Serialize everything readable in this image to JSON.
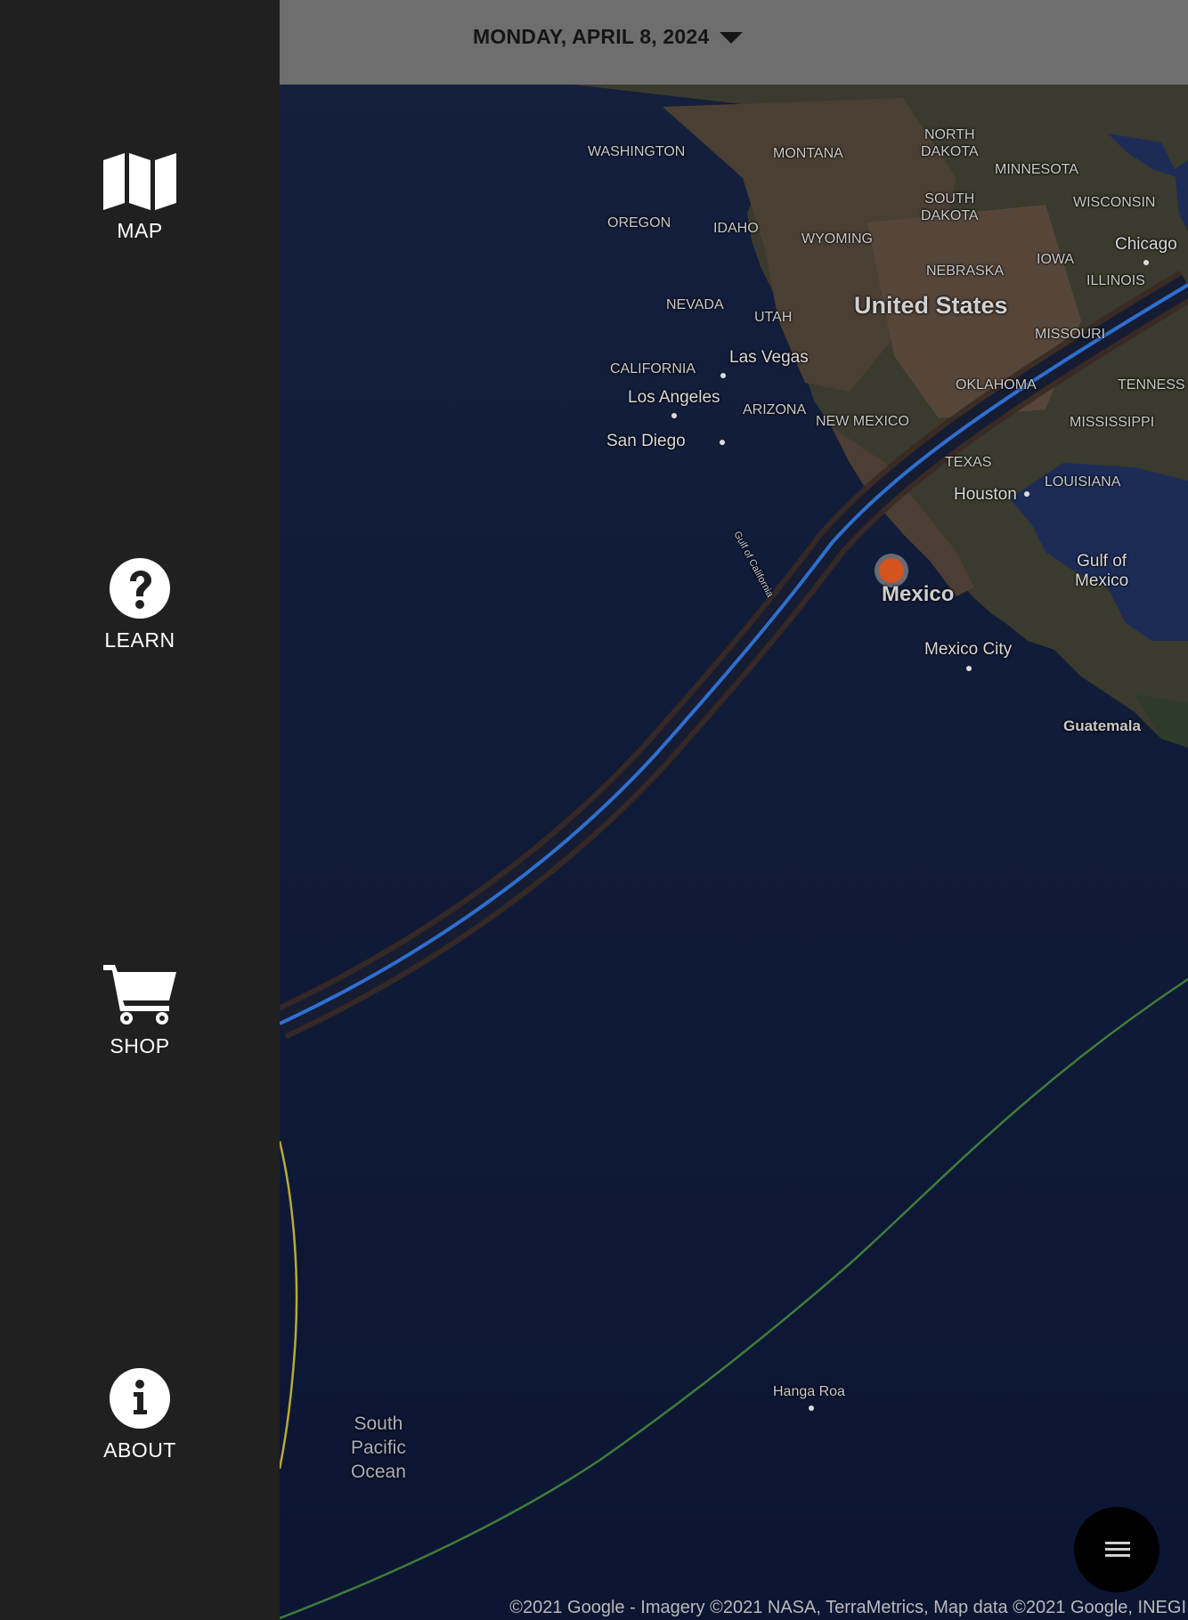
{
  "sidebar": {
    "items": [
      {
        "label": "MAP",
        "icon": "map-icon"
      },
      {
        "label": "LEARN",
        "icon": "question-circle-icon"
      },
      {
        "label": "SHOP",
        "icon": "cart-icon"
      },
      {
        "label": "ABOUT",
        "icon": "info-circle-icon"
      }
    ]
  },
  "header": {
    "date": "MONDAY, APRIL 8, 2024",
    "dropdown_icon": "caret-down-icon"
  },
  "map": {
    "labels": {
      "washington": "WASHINGTON",
      "montana": "MONTANA",
      "north_dakota": "NORTH\nDAKOTA",
      "minnesota": "MINNESOTA",
      "wisconsin": "WISCONSIN",
      "oregon": "OREGON",
      "idaho": "IDAHO",
      "wyoming": "WYOMING",
      "south_dakota": "SOUTH\nDAKOTA",
      "chicago": "Chicago",
      "iowa": "IOWA",
      "nebraska": "NEBRASKA",
      "illinois": "ILLINOIS",
      "nevada": "NEVADA",
      "utah": "UTAH",
      "united_states": "United States",
      "missouri": "MISSOURI",
      "california": "CALIFORNIA",
      "las_vegas": "Las Vegas",
      "los_angeles": "Los Angeles",
      "oklahoma": "OKLAHOMA",
      "tennessee": "TENNESS",
      "arizona": "ARIZONA",
      "new_mexico": "NEW MEXICO",
      "mississippi": "MISSISSIPPI",
      "san_diego": "San Diego",
      "texas": "TEXAS",
      "houston": "Houston",
      "louisiana": "LOUISIANA",
      "gulf_of_california": "Gulf of California",
      "gulf_of_mexico": "Gulf of\nMexico",
      "mexico": "Mexico",
      "mexico_city": "Mexico City",
      "guatemala": "Guatemala",
      "hanga_roa": "Hanga Roa",
      "south_pacific_ocean": "South\nPacific\nOcean"
    },
    "copyright": "©2021 Google - Imagery ©2021 NASA, TerraMetrics, Map data ©2021 Google, INEGI",
    "menu_button_icon": "hamburger-menu-icon",
    "colors": {
      "path_center": "#2f6fcf",
      "path_edge": "#3a2a24",
      "green_line": "#3f7d3a",
      "yellow_line": "#b8a93a",
      "marker": "#d4531f"
    }
  }
}
